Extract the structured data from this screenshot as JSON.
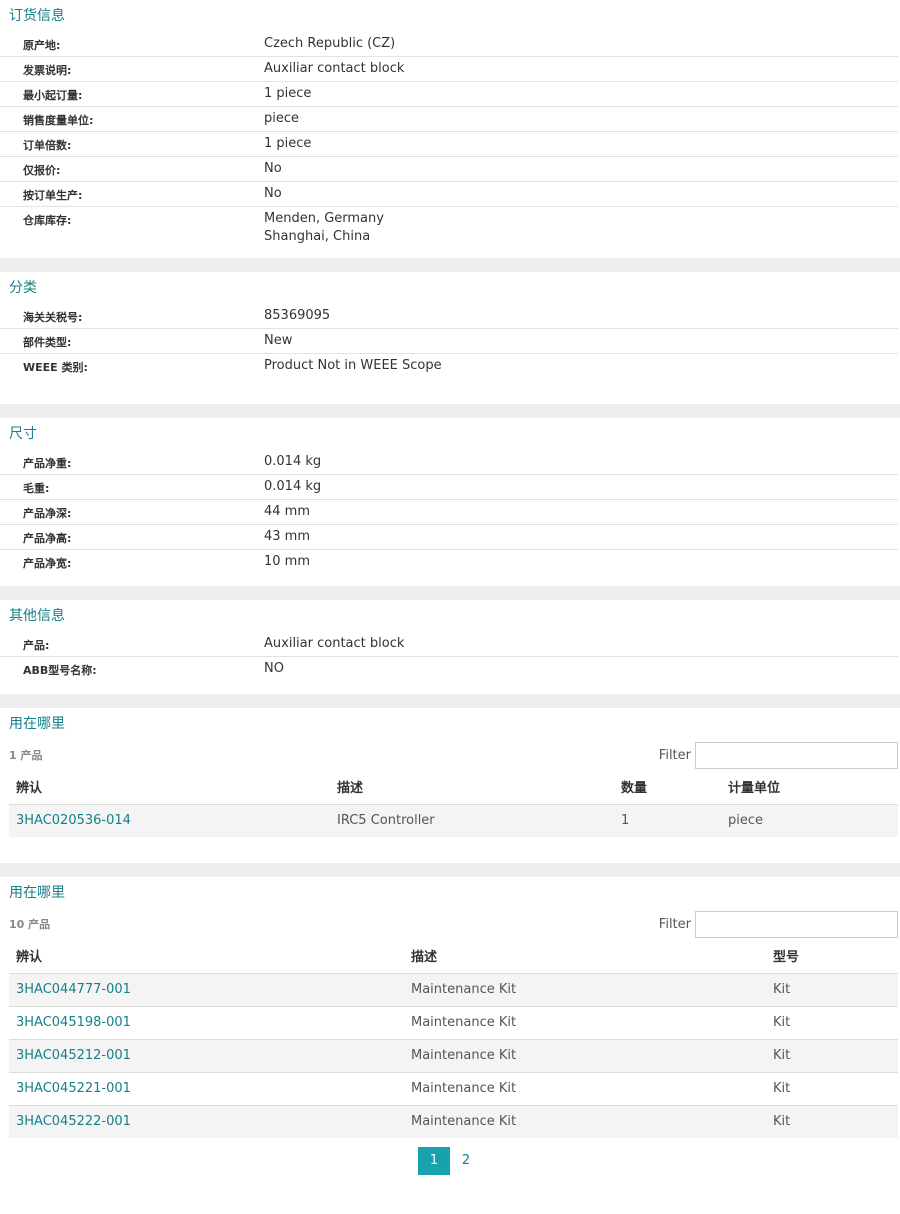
{
  "order_info": {
    "title": "订货信息",
    "rows": [
      {
        "label": "原产地:",
        "value": [
          "Czech Republic (CZ)"
        ]
      },
      {
        "label": "发票说明:",
        "value": [
          "Auxiliar contact block"
        ]
      },
      {
        "label": "最小起订量:",
        "value": [
          "1 piece"
        ]
      },
      {
        "label": "销售度量单位:",
        "value": [
          "piece"
        ]
      },
      {
        "label": "订单倍数:",
        "value": [
          "1 piece"
        ]
      },
      {
        "label": "仅报价:",
        "value": [
          "No"
        ]
      },
      {
        "label": "按订单生产:",
        "value": [
          "No"
        ]
      },
      {
        "label": "仓库库存:",
        "value": [
          "Menden, Germany",
          "Shanghai, China"
        ]
      }
    ]
  },
  "classification": {
    "title": "分类",
    "rows": [
      {
        "label": "海关关税号:",
        "value": [
          "85369095"
        ]
      },
      {
        "label": "部件类型:",
        "value": [
          "New"
        ]
      },
      {
        "label": "WEEE 类别:",
        "value": [
          "Product Not in WEEE Scope"
        ]
      }
    ]
  },
  "dimensions": {
    "title": "尺寸",
    "rows": [
      {
        "label": "产品净重:",
        "value": [
          "0.014 kg"
        ]
      },
      {
        "label": "毛重:",
        "value": [
          "0.014 kg"
        ]
      },
      {
        "label": "产品净深:",
        "value": [
          "44 mm"
        ]
      },
      {
        "label": "产品净高:",
        "value": [
          "43 mm"
        ]
      },
      {
        "label": "产品净宽:",
        "value": [
          "10 mm"
        ]
      }
    ]
  },
  "other_info": {
    "title": "其他信息",
    "rows": [
      {
        "label": "产品:",
        "value": [
          "Auxiliar contact block"
        ]
      },
      {
        "label": "ABB型号名称:",
        "value": [
          "NO"
        ]
      }
    ]
  },
  "used_in_1": {
    "title": "用在哪里",
    "count": "1 产品",
    "filter_label": "Filter",
    "headers": [
      "辨认",
      "描述",
      "数量",
      "计量单位"
    ],
    "rows": [
      [
        "3HAC020536-014",
        "IRC5 Controller",
        "1",
        "piece"
      ]
    ]
  },
  "used_in_2": {
    "title": "用在哪里",
    "count": "10 产品",
    "filter_label": "Filter",
    "headers": [
      "辨认",
      "描述",
      "型号"
    ],
    "rows": [
      [
        "3HAC044777-001",
        "Maintenance Kit",
        "Kit"
      ],
      [
        "3HAC045198-001",
        "Maintenance Kit",
        "Kit"
      ],
      [
        "3HAC045212-001",
        "Maintenance Kit",
        "Kit"
      ],
      [
        "3HAC045221-001",
        "Maintenance Kit",
        "Kit"
      ],
      [
        "3HAC045222-001",
        "Maintenance Kit",
        "Kit"
      ]
    ],
    "pages": [
      "1",
      "2"
    ],
    "current_page": "1"
  }
}
